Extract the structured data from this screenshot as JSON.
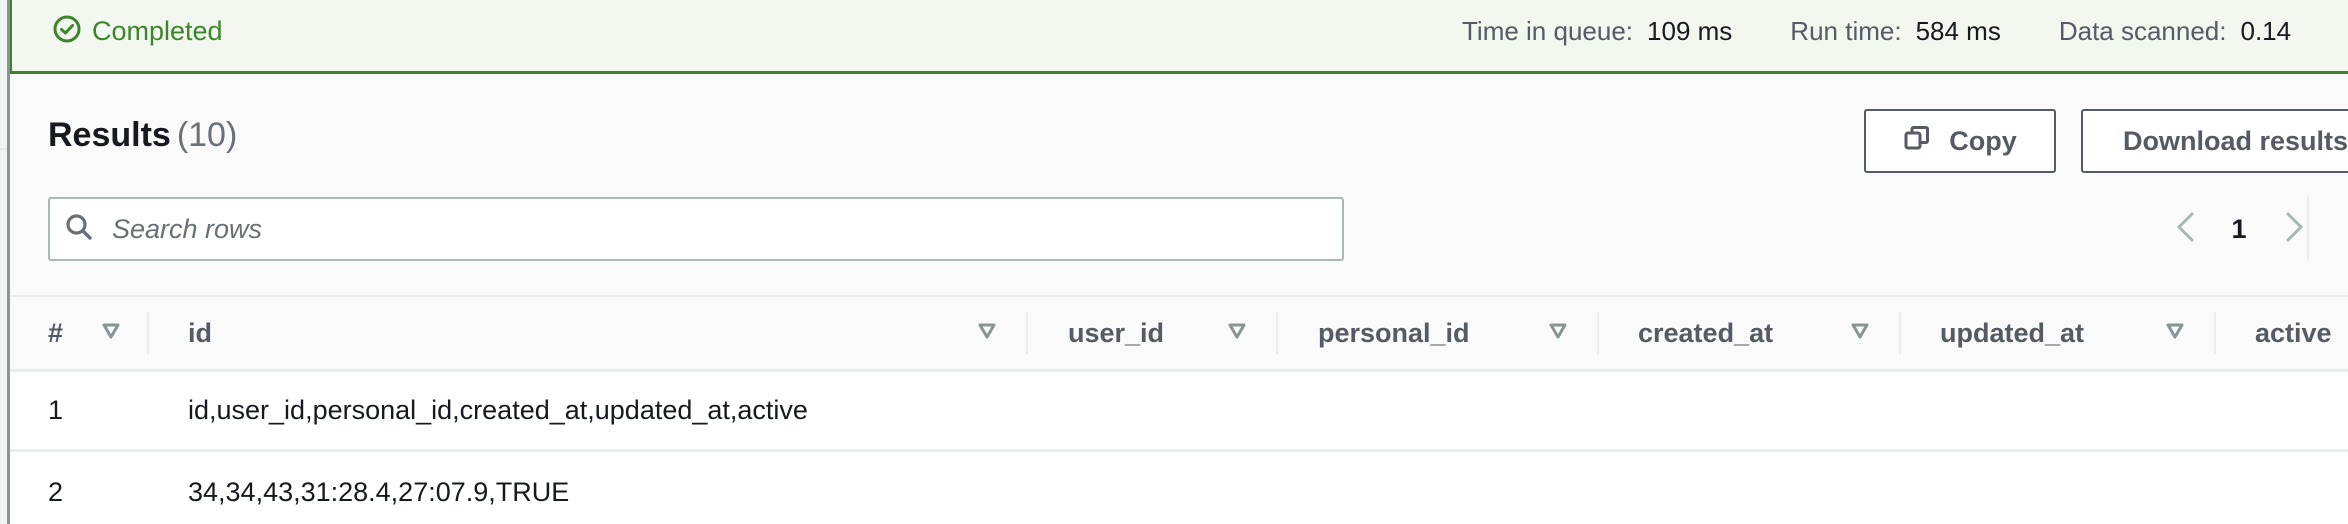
{
  "status": {
    "icon": "check-circle-icon",
    "label": "Completed",
    "color": "#3d8529"
  },
  "metrics": [
    {
      "label": "Time in queue:",
      "value": "109 ms"
    },
    {
      "label": "Run time:",
      "value": "584 ms"
    },
    {
      "label": "Data scanned:",
      "value": "0.14"
    }
  ],
  "results": {
    "title": "Results",
    "count": "(10)"
  },
  "toolbar": {
    "copy_label": "Copy",
    "copy_icon": "copy-icon",
    "download_label": "Download results"
  },
  "search": {
    "placeholder": "Search rows",
    "value": ""
  },
  "pagination": {
    "current_page": "1"
  },
  "table": {
    "columns": [
      "#",
      "id",
      "user_id",
      "personal_id",
      "created_at",
      "updated_at",
      "active"
    ],
    "rows": [
      {
        "num": "1",
        "id": "id,user_id,personal_id,created_at,updated_at,active"
      },
      {
        "num": "2",
        "id": "34,34,43,31:28.4,27:07.9,TRUE"
      }
    ]
  }
}
